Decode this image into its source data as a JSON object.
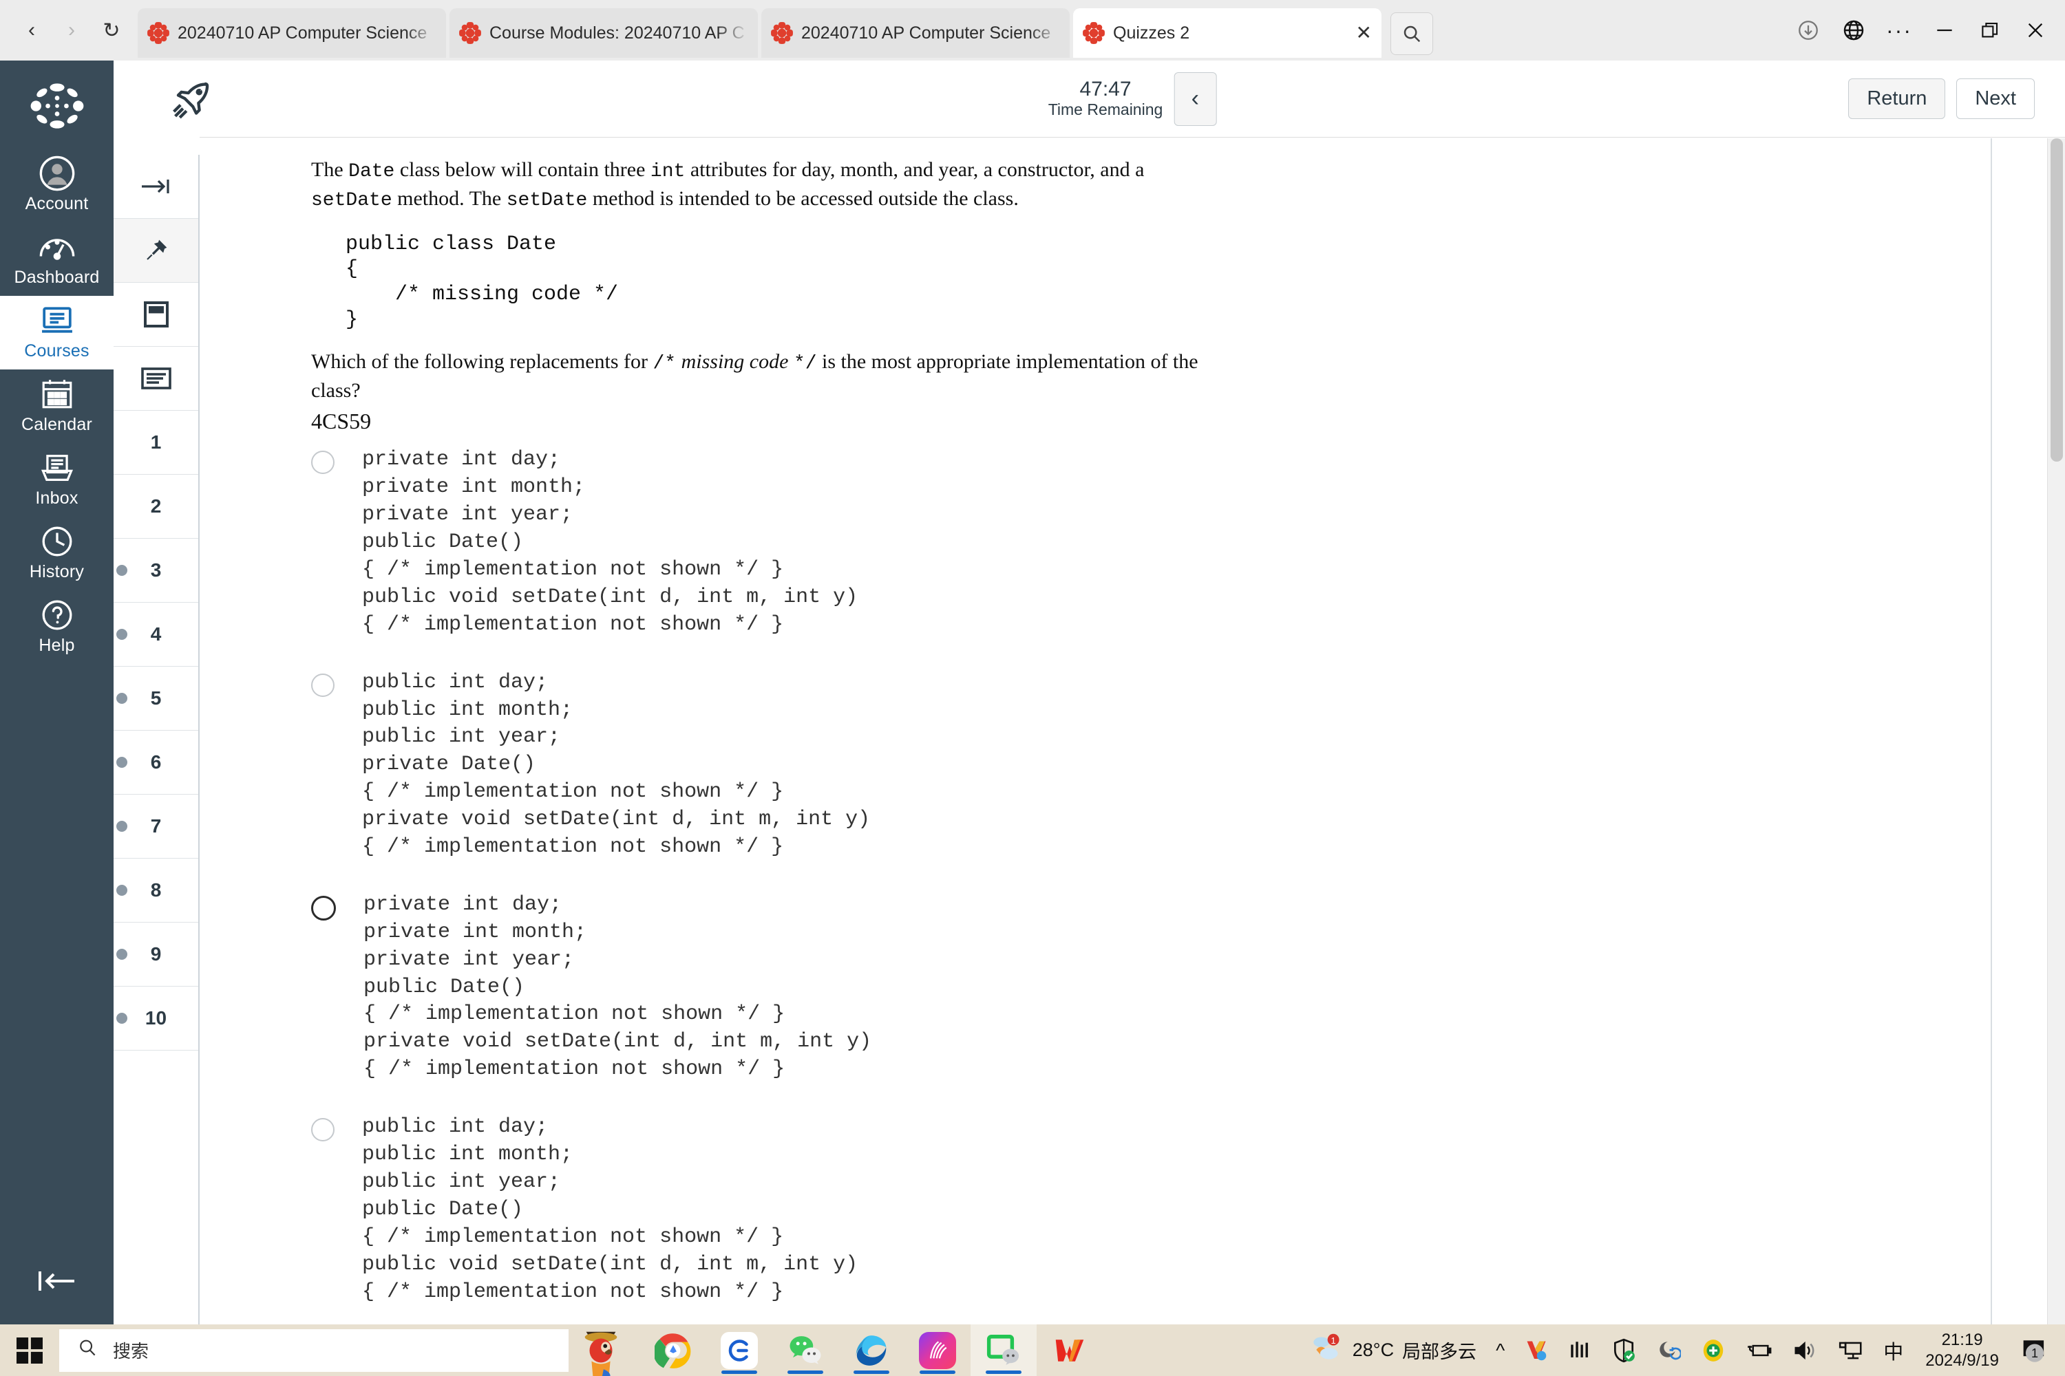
{
  "browser": {
    "nav": {
      "back": "‹",
      "forward": "›",
      "reload": "↻"
    },
    "tabs": [
      {
        "title": "20240710 AP Computer Science",
        "icon": "canvas-icon",
        "active": false
      },
      {
        "title": "Course Modules: 20240710 AP C",
        "icon": "canvas-icon",
        "active": false
      },
      {
        "title": "20240710 AP Computer Science",
        "icon": "canvas-icon",
        "active": false
      },
      {
        "title": "Quizzes 2",
        "icon": "canvas-icon",
        "active": true
      }
    ],
    "tab_close_label": "✕",
    "tab_search_label": "search-tabs",
    "window_controls": {
      "downloads": "downloads-icon",
      "globe": "globe-icon",
      "more": "···",
      "minimize": "—",
      "restore": "restore-icon",
      "close": "✕"
    }
  },
  "global_nav": {
    "logo": "canvas-logo",
    "items": [
      {
        "label": "Account",
        "icon": "user-icon",
        "active": false
      },
      {
        "label": "Dashboard",
        "icon": "dashboard-icon",
        "active": false
      },
      {
        "label": "Courses",
        "icon": "courses-icon",
        "active": true
      },
      {
        "label": "Calendar",
        "icon": "calendar-icon",
        "active": false
      },
      {
        "label": "Inbox",
        "icon": "inbox-icon",
        "active": false
      },
      {
        "label": "History",
        "icon": "clock-icon",
        "active": false
      },
      {
        "label": "Help",
        "icon": "question-icon",
        "active": false
      }
    ],
    "collapse_label": "collapse-nav"
  },
  "question_rail": {
    "tools": [
      {
        "icon": "expand-right-icon",
        "shaded": false
      },
      {
        "icon": "pin-icon",
        "shaded": true
      },
      {
        "icon": "note-icon",
        "shaded": false
      },
      {
        "icon": "list-icon",
        "shaded": false
      }
    ],
    "questions": [
      {
        "num": "1",
        "flagged": false
      },
      {
        "num": "2",
        "flagged": false
      },
      {
        "num": "3",
        "flagged": true
      },
      {
        "num": "4",
        "flagged": true
      },
      {
        "num": "5",
        "flagged": true
      },
      {
        "num": "6",
        "flagged": true
      },
      {
        "num": "7",
        "flagged": true
      },
      {
        "num": "8",
        "flagged": true
      },
      {
        "num": "9",
        "flagged": true
      },
      {
        "num": "10",
        "flagged": true
      }
    ]
  },
  "quiz_header": {
    "rocket_icon": "rocket-icon",
    "time_remaining": "47:47",
    "time_label": "Time Remaining",
    "collapse_icon": "chevron-left-icon",
    "return_label": "Return",
    "next_label": "Next"
  },
  "question": {
    "prompt_part1": "The ",
    "prompt_code1": "Date",
    "prompt_part2": " class below will contain three ",
    "prompt_code2": "int",
    "prompt_part3": " attributes for day, month, and year, a constructor, and a ",
    "prompt_code3": "setDate",
    "prompt_part4": " method. The ",
    "prompt_code4": "setDate",
    "prompt_part5": " method is intended to be accessed outside the class.",
    "code_block": "public class Date\n{\n    /* missing code */\n}",
    "question_part1": "Which of the following replacements for ",
    "question_code_open": "/*",
    "question_italic": "missing code",
    "question_code_close": "*/",
    "question_part2": " is the most appropriate implementation of the class?",
    "question_id": "4CS59",
    "options": [
      {
        "selected": false,
        "code": "private int day;\nprivate int month;\nprivate int year;\npublic Date()\n{ /* implementation not shown */ }\npublic void setDate(int d, int m, int y)\n{ /* implementation not shown */ }"
      },
      {
        "selected": false,
        "code": "public int day;\npublic int month;\npublic int year;\nprivate Date()\n{ /* implementation not shown */ }\nprivate void setDate(int d, int m, int y)\n{ /* implementation not shown */ }"
      },
      {
        "selected": true,
        "code": "private int day;\nprivate int month;\nprivate int year;\npublic Date()\n{ /* implementation not shown */ }\nprivate void setDate(int d, int m, int y)\n{ /* implementation not shown */ }"
      },
      {
        "selected": false,
        "code": "public int day;\npublic int month;\npublic int year;\npublic Date()\n{ /* implementation not shown */ }\npublic void setDate(int d, int m, int y)\n{ /* implementation not shown */ }"
      }
    ]
  },
  "taskbar": {
    "start_icon": "windows-start-icon",
    "search_placeholder": "搜索",
    "search_icon": "search-icon",
    "apps": [
      {
        "name": "parrot-icon",
        "running": false
      },
      {
        "name": "chrome-icon",
        "running": false
      },
      {
        "name": "browser-e-icon",
        "running": true
      },
      {
        "name": "wechat-icon",
        "running": true
      },
      {
        "name": "edge-icon",
        "running": true
      },
      {
        "name": "kuaishou-icon",
        "running": true
      },
      {
        "name": "green-chat-icon",
        "running": true
      },
      {
        "name": "wps-icon",
        "running": false
      }
    ],
    "weather_temp": "28°C",
    "weather_desc": "局部多云",
    "weather_badge": "1",
    "tray_chevron": "^",
    "tray_icons": [
      "v-app-icon",
      "iml-icon",
      "shield-icon",
      "sync-icon",
      "plus-circle-icon",
      "battery-icon",
      "volume-icon",
      "network-icon"
    ],
    "ime_label": "中",
    "clock_time": "21:19",
    "clock_date": "2024/9/19",
    "notification_badge": "1",
    "notification_icon": "notification-icon"
  },
  "colors": {
    "canvas_nav": "#394B58",
    "accent_blue": "#1a6fb5",
    "canvas_red": "#e03e2d",
    "taskbar": "#e8e0d0",
    "browser_bar": "#ececec"
  }
}
